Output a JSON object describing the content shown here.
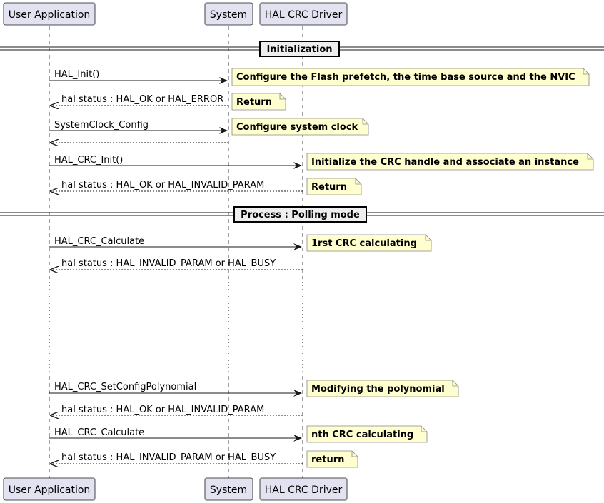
{
  "participants": [
    {
      "id": "user",
      "label": "User Application"
    },
    {
      "id": "system",
      "label": "System"
    },
    {
      "id": "driver",
      "label": "HAL CRC Driver"
    }
  ],
  "groups": [
    {
      "label": "Initialization"
    },
    {
      "label": "Process : Polling mode"
    }
  ],
  "messages": [
    {
      "label": "HAL_Init()"
    },
    {
      "label": "hal status : HAL_OK or HAL_ERROR"
    },
    {
      "label": "SystemClock_Config"
    },
    {
      "label": ""
    },
    {
      "label": "HAL_CRC_Init()"
    },
    {
      "label": "hal status : HAL_OK or HAL_INVALID_PARAM"
    },
    {
      "label": "HAL_CRC_Calculate"
    },
    {
      "label": "hal status : HAL_INVALID_PARAM or HAL_BUSY"
    },
    {
      "label": "HAL_CRC_SetConfigPolynomial"
    },
    {
      "label": "hal status : HAL_OK or HAL_INVALID_PARAM"
    },
    {
      "label": "HAL_CRC_Calculate"
    },
    {
      "label": "hal status : HAL_INVALID_PARAM or HAL_BUSY"
    }
  ],
  "notes": [
    {
      "text": "Configure the Flash prefetch, the time base source and the NVIC"
    },
    {
      "text": "Return"
    },
    {
      "text": "Configure system clock"
    },
    {
      "text": "Initialize the CRC handle and associate an instance"
    },
    {
      "text": "Return"
    },
    {
      "text": "1rst CRC calculating"
    },
    {
      "text": "Modifying the polynomial"
    },
    {
      "text": "nth CRC calculating"
    },
    {
      "text": "return"
    }
  ],
  "colors": {
    "participant_fill": "#e2e2f0",
    "participant_stroke": "#181818",
    "note_fill": "#fefece",
    "note_stroke": "#888888",
    "line": "#181818"
  }
}
